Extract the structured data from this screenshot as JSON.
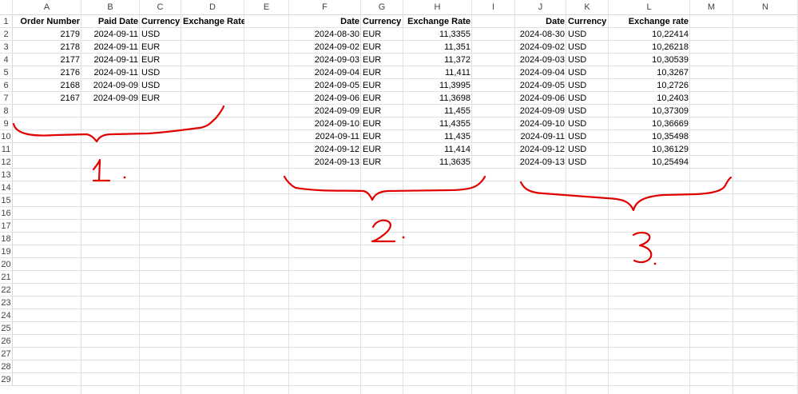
{
  "columns": [
    "A",
    "B",
    "C",
    "D",
    "E",
    "F",
    "G",
    "H",
    "I",
    "J",
    "K",
    "L",
    "M",
    "N"
  ],
  "rows": [
    "1",
    "2",
    "3",
    "4",
    "5",
    "6",
    "7",
    "8",
    "9",
    "10",
    "11",
    "12",
    "13",
    "14",
    "15",
    "16",
    "17",
    "18",
    "19",
    "20",
    "21",
    "22",
    "23",
    "24",
    "25",
    "26",
    "27",
    "28",
    "29"
  ],
  "table1": {
    "headers": [
      "Order Number",
      "Paid Date",
      "Currency",
      "Exchange Rate"
    ],
    "rows": [
      [
        "2179",
        "2024-09-11",
        "USD",
        ""
      ],
      [
        "2178",
        "2024-09-11",
        "EUR",
        ""
      ],
      [
        "2177",
        "2024-09-11",
        "EUR",
        ""
      ],
      [
        "2176",
        "2024-09-11",
        "USD",
        ""
      ],
      [
        "2168",
        "2024-09-09",
        "USD",
        ""
      ],
      [
        "2167",
        "2024-09-09",
        "EUR",
        ""
      ]
    ]
  },
  "table2": {
    "headers": [
      "Date",
      "Currency",
      "Exchange Rate"
    ],
    "rows": [
      [
        "2024-08-30",
        "EUR",
        "11,3355"
      ],
      [
        "2024-09-02",
        "EUR",
        "11,351"
      ],
      [
        "2024-09-03",
        "EUR",
        "11,372"
      ],
      [
        "2024-09-04",
        "EUR",
        "11,411"
      ],
      [
        "2024-09-05",
        "EUR",
        "11,3995"
      ],
      [
        "2024-09-06",
        "EUR",
        "11,3698"
      ],
      [
        "2024-09-09",
        "EUR",
        "11,455"
      ],
      [
        "2024-09-10",
        "EUR",
        "11,4355"
      ],
      [
        "2024-09-11",
        "EUR",
        "11,435"
      ],
      [
        "2024-09-12",
        "EUR",
        "11,414"
      ],
      [
        "2024-09-13",
        "EUR",
        "11,3635"
      ]
    ]
  },
  "table3": {
    "headers": [
      "Date",
      "Currency",
      "Exchange rate"
    ],
    "rows": [
      [
        "2024-08-30",
        "USD",
        "10,22414"
      ],
      [
        "2024-09-02",
        "USD",
        "10,26218"
      ],
      [
        "2024-09-03",
        "USD",
        "10,30539"
      ],
      [
        "2024-09-04",
        "USD",
        "10,3267"
      ],
      [
        "2024-09-05",
        "USD",
        "10,2726"
      ],
      [
        "2024-09-06",
        "USD",
        "10,2403"
      ],
      [
        "2024-09-09",
        "USD",
        "10,37309"
      ],
      [
        "2024-09-10",
        "USD",
        "10,36669"
      ],
      [
        "2024-09-11",
        "USD",
        "10,35498"
      ],
      [
        "2024-09-12",
        "USD",
        "10,36129"
      ],
      [
        "2024-09-13",
        "USD",
        "10,25494"
      ]
    ]
  },
  "annotations": {
    "color": "#e00000",
    "labels": [
      "1.",
      "2.",
      "3."
    ]
  }
}
